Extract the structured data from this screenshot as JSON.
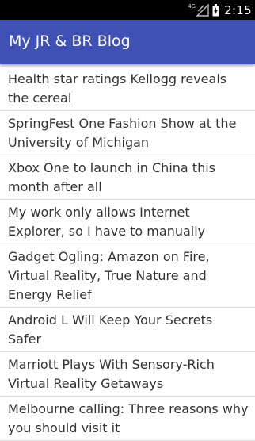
{
  "status_bar": {
    "network_type": "4G",
    "time": "2:15",
    "icons": [
      "signal-icon",
      "battery-charging-icon"
    ]
  },
  "app_bar": {
    "title": "My JR & BR Blog",
    "color": "#3f51b5"
  },
  "posts": [
    {
      "title": "Health star ratings Kellogg reveals the cereal"
    },
    {
      "title": "SpringFest One Fashion Show at the University of Michigan"
    },
    {
      "title": "Xbox One to launch in China this month after all"
    },
    {
      "title": "My work only allows Internet Explorer, so I have to manually"
    },
    {
      "title": "Gadget Ogling: Amazon on Fire, Virtual Reality, True Nature and Energy Relief"
    },
    {
      "title": "Android L Will Keep Your Secrets Safer"
    },
    {
      "title": "Marriott Plays With Sensory-Rich Virtual Reality Getaways"
    },
    {
      "title": "Melbourne calling: Three reasons why you should visit it"
    }
  ]
}
